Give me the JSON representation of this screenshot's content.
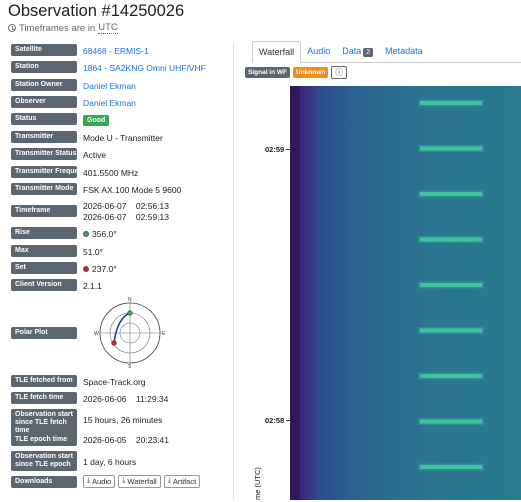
{
  "header": {
    "title": "Observation #14250026",
    "timezone_prefix": "Timeframes are in",
    "timezone": "UTC"
  },
  "details": [
    {
      "label": "Satellite",
      "value": "68468 - ERMIS-1",
      "link": true
    },
    {
      "label": "Station",
      "value": "1864 - SA2KNG Omni UHF/VHF",
      "link": true
    },
    {
      "label": "Station Owner",
      "value": "Daniel Ekman",
      "link": true
    },
    {
      "label": "Observer",
      "value": "Daniel Ekman",
      "link": true
    },
    {
      "label": "Status",
      "value": "Good"
    },
    {
      "label": "Transmitter",
      "value": "Mode U - Transmitter"
    },
    {
      "label": "Transmitter Status",
      "value": "Active"
    },
    {
      "label": "Transmitter Frequency",
      "value": "401.5500 MHz"
    },
    {
      "label": "Transmitter Mode",
      "value": "FSK AX.100 Mode 5 9600"
    },
    {
      "label": "Timeframe",
      "value_start": "2026-06-07    02:56:13",
      "value_end": "2026-06-07    02:59:13"
    },
    {
      "label": "Rise",
      "value": "356.0°"
    },
    {
      "label": "Max",
      "value": "51.0°"
    },
    {
      "label": "Set",
      "value": "237.0°"
    },
    {
      "label": "Client Version",
      "value": "2.1.1"
    },
    {
      "label": "Polar Plot"
    },
    {
      "label": "TLE fetched from",
      "value": "Space-Track.org"
    },
    {
      "label": "TLE fetch time",
      "value": "2026-06-06    11:29:34"
    },
    {
      "label": "Observation start since TLE fetch time",
      "value": "15 hours, 26 minutes"
    },
    {
      "label": "TLE epoch time",
      "value": "2026-06-05    20:23:41"
    },
    {
      "label": "Observation start since TLE epoch",
      "value": "1 day, 6 hours"
    },
    {
      "label": "Downloads"
    }
  ],
  "polar": {
    "n": "N",
    "e": "E",
    "s": "S",
    "w": "W"
  },
  "downloads": [
    "Audio",
    "Waterfall",
    "Artifact"
  ],
  "tabs": [
    {
      "label": "Waterfall",
      "active": true
    },
    {
      "label": "Audio"
    },
    {
      "label": "Data",
      "count": "2"
    },
    {
      "label": "Metadata"
    }
  ],
  "waterfall": {
    "signal_label": "Signal in WF",
    "signal_status": "Unknown",
    "info_icon": "info-icon",
    "ticks": [
      "02:59",
      "02:58"
    ],
    "axis_label": "me (UTC)"
  },
  "colors": {
    "link": "#1a73e8",
    "label_bg": "#5c6670",
    "good": "#34a853",
    "unknown": "#f28c1a",
    "rise_dot": "#34a853",
    "set_dot": "#cc2222"
  }
}
